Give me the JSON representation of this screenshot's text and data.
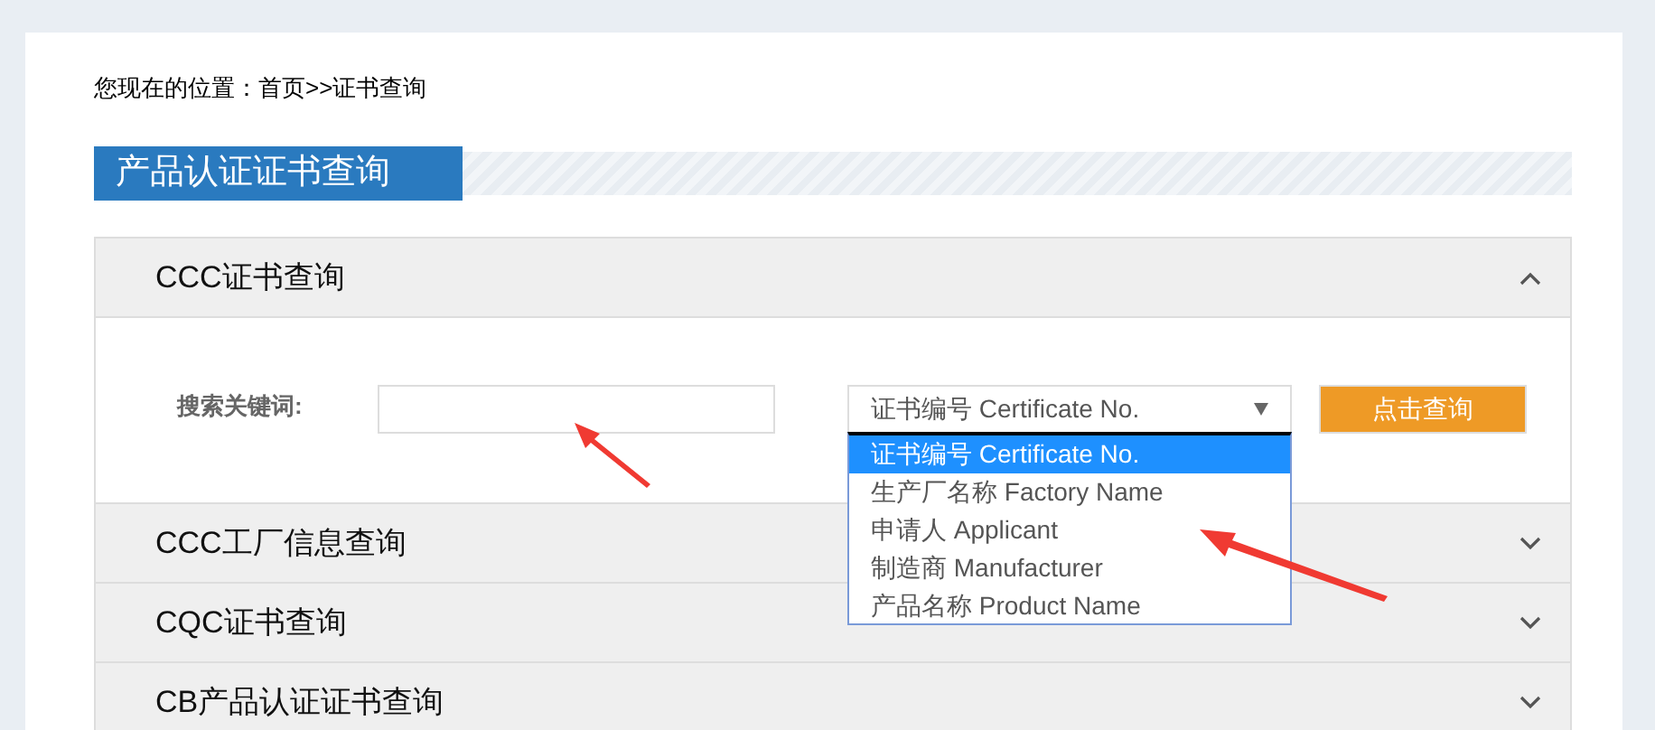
{
  "breadcrumb": "您现在的位置：首页>>证书查询",
  "banner": {
    "title": "产品认证证书查询"
  },
  "sections": [
    {
      "title": "CCC证书查询",
      "expanded": true
    },
    {
      "title": "CCC工厂信息查询",
      "expanded": false
    },
    {
      "title": "CQC证书查询",
      "expanded": false
    },
    {
      "title": "CB产品认证证书查询",
      "expanded": false
    }
  ],
  "search": {
    "label": "搜索关键词:",
    "select_value": "证书编号 Certificate No.",
    "button": "点击查询",
    "options": [
      {
        "label": "证书编号 Certificate No.",
        "selected": true
      },
      {
        "label": "生产厂名称 Factory Name",
        "selected": false
      },
      {
        "label": "申请人 Applicant",
        "selected": false
      },
      {
        "label": "制造商 Manufacturer",
        "selected": false
      },
      {
        "label": "产品名称 Product Name",
        "selected": false
      }
    ]
  }
}
